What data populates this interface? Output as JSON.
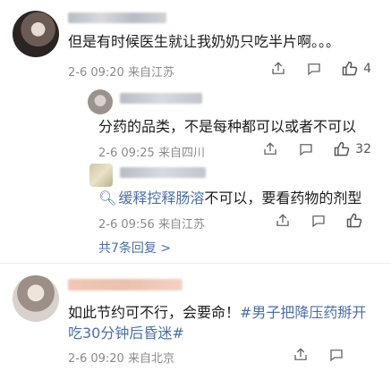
{
  "comment_main": {
    "text": "但是有时候医生就让我奶奶只吃半片啊。。。",
    "time": "2-6 09:20",
    "location": "来自江苏",
    "likes": "4"
  },
  "reply_1": {
    "text": "分药的品类，不是每种都可以或者不可以",
    "time": "2-6 09:25",
    "location": "来自四川",
    "likes": "32"
  },
  "reply_2": {
    "link_text": "缓释控释肠溶",
    "text_rest": "不可以，要看药物的剂型",
    "time": "2-6 09:56",
    "location": "来自江苏"
  },
  "more_replies": {
    "label": "共7条回复 >"
  },
  "comment_third": {
    "text_plain": "如此节约可不行，会要命！",
    "hashtag_line1": "#男子把降压药掰开",
    "hashtag_line2": "吃30分钟后昏迷#",
    "time": "2-6 09:20",
    "location": "来自北京"
  },
  "colors": {
    "link": "#4a6ea8",
    "meta": "#8a8a8a"
  }
}
